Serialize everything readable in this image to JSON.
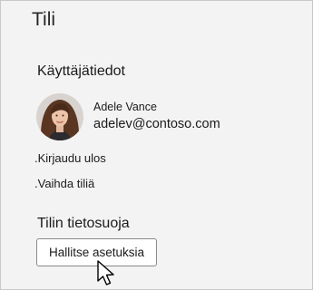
{
  "panel": {
    "title": "Tili",
    "user_info": {
      "heading": "Käyttäjätiedot",
      "name": "Adele Vance",
      "email": "adelev@contoso.com",
      "avatar_icon": "user-avatar-photo"
    },
    "links": {
      "sign_out": ".Kirjaudu ulos",
      "switch_account": ".Vaihda tiliä"
    },
    "privacy": {
      "heading": "Tilin tietosuoja",
      "manage_button": "Hallitse asetuksia"
    },
    "cursor_icon": "mouse-pointer-icon"
  }
}
